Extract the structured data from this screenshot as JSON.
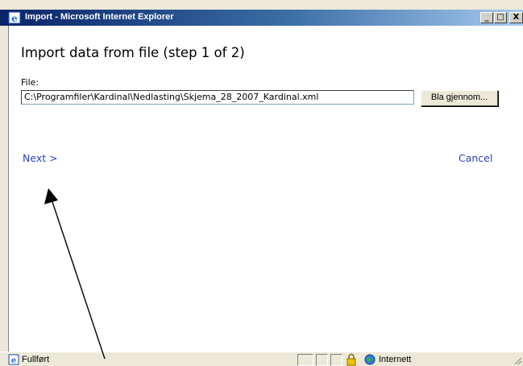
{
  "window": {
    "title": "Import - Microsoft Internet Explorer",
    "controls": {
      "minimize": "_",
      "maximize": "□",
      "close": "X"
    }
  },
  "page": {
    "heading": "Import data from file (step 1 of 2)",
    "file_label": "File:",
    "file_value": "C:\\Programfiler\\Kardinal\\Nedlasting\\Skjema_28_2007_Kardinal.xml",
    "browse_label": "Bla gjennom...",
    "next_label": "Next >",
    "cancel_label": "Cancel"
  },
  "statusbar": {
    "status_text": "Fullført",
    "zone_text": "Internett"
  },
  "colors": {
    "link": "#2b3fb0",
    "titlebar": "#0a246a",
    "chrome": "#ece9d8"
  },
  "icons": [
    "ie-icon",
    "page-done-icon",
    "lock-icon",
    "globe-icon",
    "resize-grip-icon",
    "annotation-arrow"
  ]
}
